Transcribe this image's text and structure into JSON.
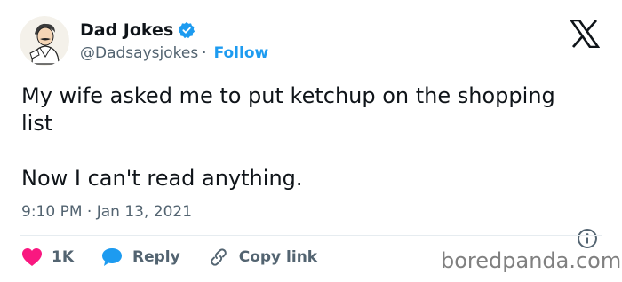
{
  "author": {
    "name": "Dad Jokes",
    "handle": "@Dadsaysjokes",
    "separator": "·",
    "follow_label": "Follow"
  },
  "tweet": {
    "lines": [
      "My wife asked me to put ketchup on the shopping",
      "list",
      "Now I can't read anything."
    ],
    "time": "9:10 PM",
    "date_separator": "·",
    "date": "Jan 13, 2021"
  },
  "actions": {
    "like_count": "1K",
    "reply_label": "Reply",
    "copy_link_label": "Copy link"
  },
  "watermark": "boredpanda.com",
  "icons": {
    "verified": "verified-badge-icon",
    "platform": "x-logo-icon",
    "info": "info-icon",
    "like": "heart-icon",
    "reply": "speech-bubble-icon",
    "link": "link-icon"
  },
  "colors": {
    "accent": "#1d9bf0",
    "like": "#f91880",
    "text": "#0f1419",
    "muted": "#536471"
  }
}
